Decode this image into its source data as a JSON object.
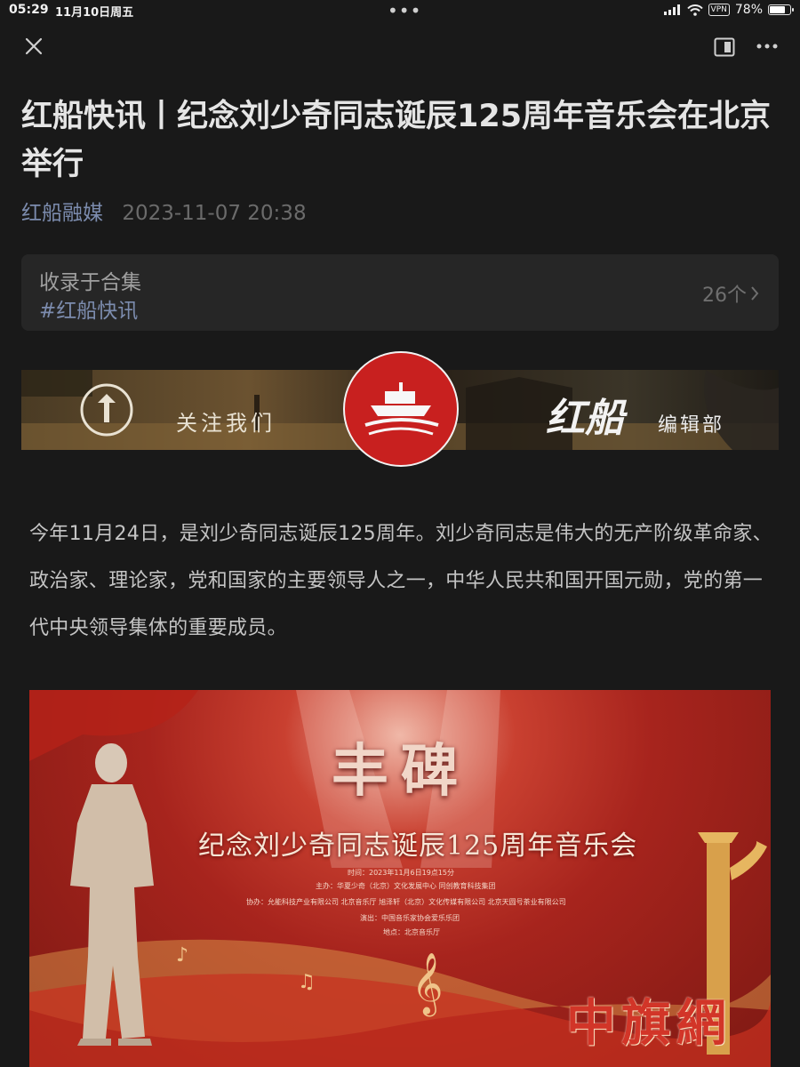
{
  "status": {
    "time": "05:29",
    "date": "11月10日周五",
    "vpn": "VPN",
    "battery_text": "78%",
    "battery_level": 0.78
  },
  "nav": {
    "close_icon": "close-icon",
    "reader_icon": "reader-mode-icon",
    "more_icon": "more-icon"
  },
  "article": {
    "title": "红船快讯丨纪念刘少奇同志诞辰125周年音乐会在北京举行",
    "author": "红船融媒",
    "date": "2023-11-07 20:38",
    "paragraph": "今年11月24日，是刘少奇同志诞辰125周年。刘少奇同志是伟大的无产阶级革命家、政治家、理论家，党和国家的主要领导人之一，中华人民共和国开国元勋，党的第一代中央领导集体的重要成员。"
  },
  "collection": {
    "label": "收录于合集",
    "tag": "#红船快讯",
    "count": "26个"
  },
  "banner": {
    "follow": "关注我们",
    "brand": "红船",
    "dept": "编辑部"
  },
  "poster": {
    "heading": "丰碑",
    "subheading": "纪念刘少奇同志诞辰125周年音乐会",
    "info": [
      "时间：2023年11月6日19点15分",
      "主办：华夏少奇（北京）文化发展中心    同创教育科技集团",
      "协办：允能科技产业有限公司    北京音乐厅    旭泽轩（北京）文化传媒有限公司    北京天圆号茶业有限公司",
      "演出：中国音乐家协会爱乐乐团",
      "地点：北京音乐厅"
    ],
    "watermark": "中旗網"
  },
  "colors": {
    "background": "#191919",
    "link": "#7c8cae",
    "accent_red": "#c8201f"
  }
}
